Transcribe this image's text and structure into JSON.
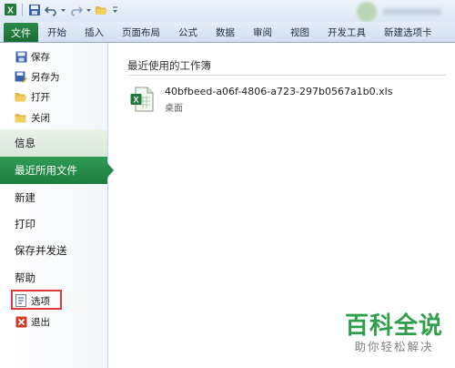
{
  "ribbon": {
    "tabs": [
      "文件",
      "开始",
      "插入",
      "页面布局",
      "公式",
      "数据",
      "审阅",
      "视图",
      "开发工具",
      "新建选项卡"
    ]
  },
  "backstage": {
    "commands_top": [
      {
        "label": "保存",
        "icon": "save-icon"
      },
      {
        "label": "另存为",
        "icon": "save-as-icon"
      },
      {
        "label": "打开",
        "icon": "open-folder-icon"
      },
      {
        "label": "关闭",
        "icon": "close-folder-icon"
      }
    ],
    "nav": [
      "信息",
      "最近所用文件",
      "新建",
      "打印",
      "保存并发送",
      "帮助"
    ],
    "commands_bottom": [
      {
        "label": "选项",
        "icon": "options-icon"
      },
      {
        "label": "退出",
        "icon": "exit-icon"
      }
    ],
    "selected_nav": "最近所用文件"
  },
  "recent": {
    "heading": "最近使用的工作簿",
    "files": [
      {
        "name": "40bfbeed-a06f-4806-a723-297b0567a1b0.xls",
        "location": "桌面"
      }
    ]
  },
  "watermark": {
    "main": "百科全说",
    "sub": "助你轻松解决"
  },
  "colors": {
    "accent": "#1e7d3d",
    "highlight_box": "#e23b3b",
    "watermark": "#2f9f4b"
  }
}
